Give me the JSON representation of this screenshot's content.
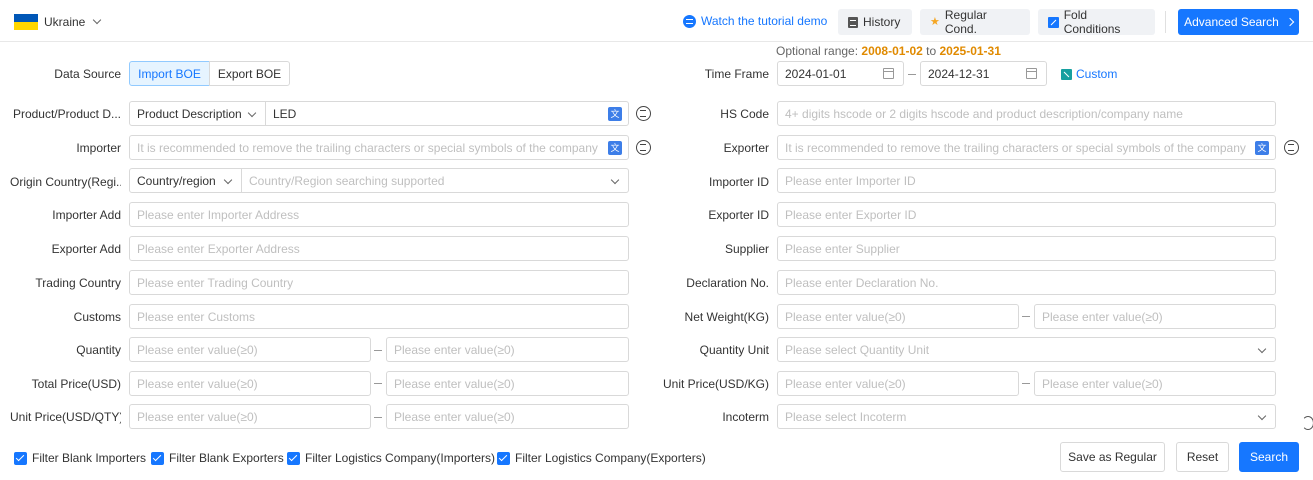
{
  "header": {
    "country": "Ukraine",
    "tutorial": "Watch the tutorial demo",
    "history": "History",
    "regular_cond": "Regular Cond.",
    "fold": "Fold Conditions",
    "advanced": "Advanced Search"
  },
  "form": {
    "data_source": {
      "label": "Data Source",
      "options": [
        "Import BOE",
        "Export BOE"
      ],
      "selected": "Import BOE"
    },
    "time_frame": {
      "label": "Time Frame",
      "optional_label": "Optional range:",
      "optional_start": "2008-01-02",
      "optional_to": "to",
      "optional_end": "2025-01-31",
      "start": "2024-01-01",
      "end": "2024-12-31",
      "custom": "Custom"
    },
    "product": {
      "label": "Product/Product D...",
      "select": "Product Description",
      "value": "LED"
    },
    "hs_code": {
      "label": "HS Code",
      "placeholder": "4+ digits hscode or 2 digits hscode and product description/company name"
    },
    "importer": {
      "label": "Importer",
      "placeholder": "It is recommended to remove the trailing characters or special symbols of the company"
    },
    "exporter": {
      "label": "Exporter",
      "placeholder": "It is recommended to remove the trailing characters or special symbols of the company"
    },
    "origin": {
      "label": "Origin Country(Regi...",
      "select": "Country/region",
      "placeholder": "Country/Region searching supported"
    },
    "importer_id": {
      "label": "Importer ID",
      "placeholder": "Please enter Importer ID"
    },
    "importer_add": {
      "label": "Importer Add",
      "placeholder": "Please enter Importer Address"
    },
    "exporter_id": {
      "label": "Exporter ID",
      "placeholder": "Please enter Exporter ID"
    },
    "exporter_add": {
      "label": "Exporter Add",
      "placeholder": "Please enter Exporter Address"
    },
    "supplier": {
      "label": "Supplier",
      "placeholder": "Please enter Supplier"
    },
    "trading_country": {
      "label": "Trading Country",
      "placeholder": "Please enter Trading Country"
    },
    "declaration": {
      "label": "Declaration No.",
      "placeholder": "Please enter Declaration No."
    },
    "customs": {
      "label": "Customs",
      "placeholder": "Please enter Customs"
    },
    "net_weight": {
      "label": "Net Weight(KG)",
      "placeholder": "Please enter value(≥0)"
    },
    "quantity": {
      "label": "Quantity",
      "placeholder": "Please enter value(≥0)"
    },
    "quantity_unit": {
      "label": "Quantity Unit",
      "placeholder": "Please select Quantity Unit"
    },
    "total_price": {
      "label": "Total Price(USD)",
      "placeholder": "Please enter value(≥0)"
    },
    "unit_price_kg": {
      "label": "Unit Price(USD/KG)",
      "placeholder": "Please enter value(≥0)"
    },
    "unit_price_qty": {
      "label": "Unit Price(USD/QTY)",
      "placeholder": "Please enter value(≥0)"
    },
    "incoterm": {
      "label": "Incoterm",
      "placeholder": "Please select Incoterm"
    }
  },
  "filters": [
    "Filter Blank Importers",
    "Filter Blank Exporters",
    "Filter Logistics Company(Importers)",
    "Filter Logistics Company(Exporters)"
  ],
  "actions": {
    "save": "Save as Regular",
    "reset": "Reset",
    "search": "Search"
  },
  "colors": {
    "primary": "#1677ff",
    "date_highlight": "#e08a00"
  }
}
